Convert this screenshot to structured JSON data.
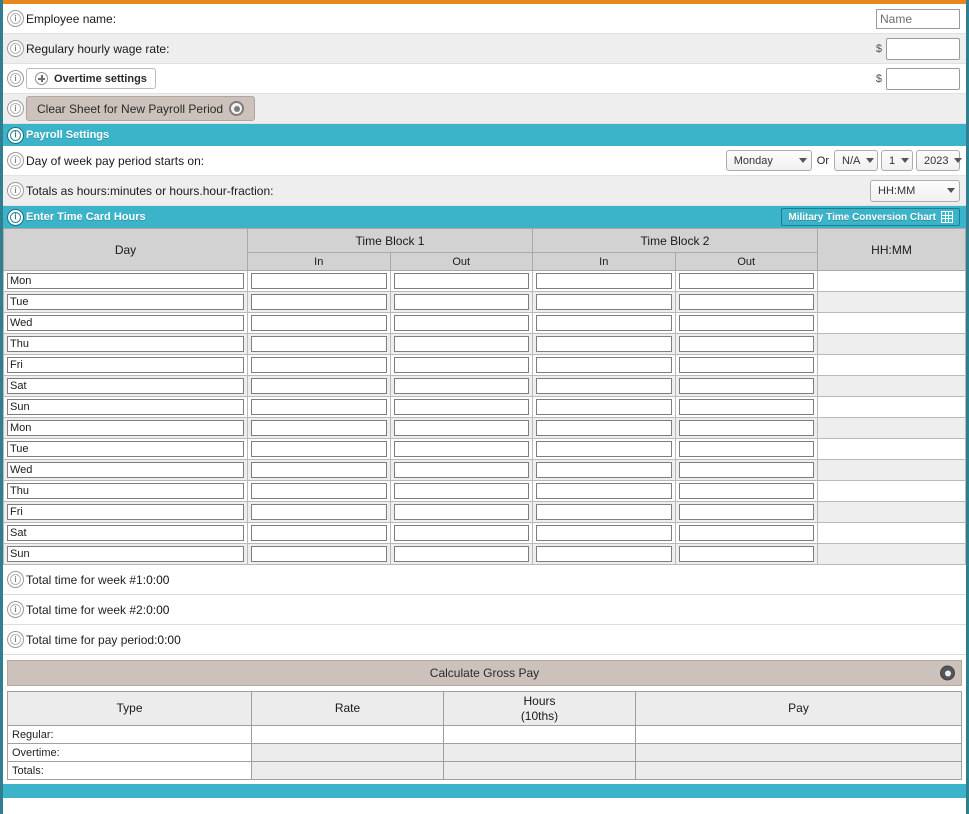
{
  "colors": {
    "accent_orange": "#e8881a",
    "teal": "#3bb3c9",
    "teal_border": "#2f7f90",
    "tan_button": "#cdc1bb",
    "header_gray": "#d2d2d2",
    "row_alt": "#eeeeee"
  },
  "fields": {
    "employee_name_label": "Employee name:",
    "employee_name_placeholder": "Name",
    "employee_name_value": "",
    "wage_label": "Regulary hourly wage rate:",
    "wage_currency": "$",
    "wage_value": "",
    "overtime_button": "Overtime settings",
    "overtime_currency": "$",
    "overtime_value": "",
    "clear_button": "Clear Sheet for New Payroll Period"
  },
  "payroll_settings": {
    "header": "Payroll Settings",
    "day_of_week_label": "Day of week pay period starts on:",
    "day_of_week_value": "Monday",
    "or_label": "Or",
    "month_value": "N/A",
    "day_value": "1",
    "year_value": "2023",
    "totals_format_label": "Totals as hours:minutes or hours.hour-fraction:",
    "totals_format_value": "HH:MM"
  },
  "time_card": {
    "header": "Enter Time Card Hours",
    "chart_button": "Military Time Conversion Chart",
    "columns": {
      "day": "Day",
      "block1": "Time Block 1",
      "block2": "Time Block 2",
      "hhmm": "HH:MM",
      "in": "In",
      "out": "Out"
    },
    "rows": [
      {
        "day": "Mon",
        "b1_in": "",
        "b1_out": "",
        "b2_in": "",
        "b2_out": "",
        "hhmm": ""
      },
      {
        "day": "Tue",
        "b1_in": "",
        "b1_out": "",
        "b2_in": "",
        "b2_out": "",
        "hhmm": ""
      },
      {
        "day": "Wed",
        "b1_in": "",
        "b1_out": "",
        "b2_in": "",
        "b2_out": "",
        "hhmm": ""
      },
      {
        "day": "Thu",
        "b1_in": "",
        "b1_out": "",
        "b2_in": "",
        "b2_out": "",
        "hhmm": ""
      },
      {
        "day": "Fri",
        "b1_in": "",
        "b1_out": "",
        "b2_in": "",
        "b2_out": "",
        "hhmm": ""
      },
      {
        "day": "Sat",
        "b1_in": "",
        "b1_out": "",
        "b2_in": "",
        "b2_out": "",
        "hhmm": ""
      },
      {
        "day": "Sun",
        "b1_in": "",
        "b1_out": "",
        "b2_in": "",
        "b2_out": "",
        "hhmm": ""
      },
      {
        "day": "Mon",
        "b1_in": "",
        "b1_out": "",
        "b2_in": "",
        "b2_out": "",
        "hhmm": ""
      },
      {
        "day": "Tue",
        "b1_in": "",
        "b1_out": "",
        "b2_in": "",
        "b2_out": "",
        "hhmm": ""
      },
      {
        "day": "Wed",
        "b1_in": "",
        "b1_out": "",
        "b2_in": "",
        "b2_out": "",
        "hhmm": ""
      },
      {
        "day": "Thu",
        "b1_in": "",
        "b1_out": "",
        "b2_in": "",
        "b2_out": "",
        "hhmm": ""
      },
      {
        "day": "Fri",
        "b1_in": "",
        "b1_out": "",
        "b2_in": "",
        "b2_out": "",
        "hhmm": ""
      },
      {
        "day": "Sat",
        "b1_in": "",
        "b1_out": "",
        "b2_in": "",
        "b2_out": "",
        "hhmm": ""
      },
      {
        "day": "Sun",
        "b1_in": "",
        "b1_out": "",
        "b2_in": "",
        "b2_out": "",
        "hhmm": ""
      }
    ]
  },
  "totals": [
    {
      "label": "Total time for week #1:",
      "value": "0:00"
    },
    {
      "label": "Total time for week #2:",
      "value": "0:00"
    },
    {
      "label": "Total time for pay period:",
      "value": "0:00"
    }
  ],
  "calculate": {
    "label": "Calculate Gross Pay"
  },
  "pay_table": {
    "headers": {
      "type": "Type",
      "rate": "Rate",
      "hours_line1": "Hours",
      "hours_line2": "(10ths)",
      "pay": "Pay"
    },
    "rows": [
      {
        "type": "Regular:",
        "rate": "",
        "hours": "",
        "pay": ""
      },
      {
        "type": "Overtime:",
        "rate": "",
        "hours": "",
        "pay": ""
      },
      {
        "type": "Totals:",
        "rate": "",
        "hours": "",
        "pay": ""
      }
    ]
  }
}
